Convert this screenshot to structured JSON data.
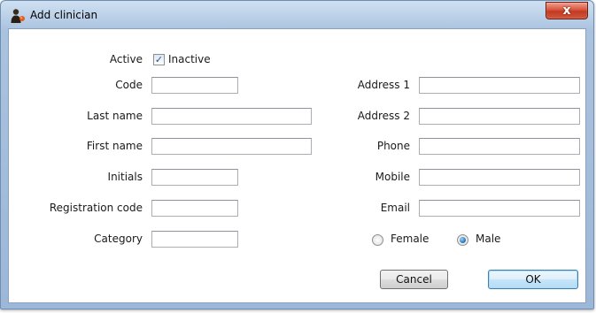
{
  "window": {
    "title": "Add clinician",
    "close_glyph": "x",
    "icon": "clinician-icon"
  },
  "form": {
    "active": {
      "label": "Active",
      "checkbox_label": "Inactive",
      "checked": true
    },
    "left_fields": [
      {
        "label": "Code",
        "value": ""
      },
      {
        "label": "Last name",
        "value": ""
      },
      {
        "label": "First name",
        "value": ""
      },
      {
        "label": "Initials",
        "value": ""
      },
      {
        "label": "Registration code",
        "value": ""
      },
      {
        "label": "Category",
        "value": ""
      }
    ],
    "right_fields": [
      {
        "label": "Address 1",
        "value": ""
      },
      {
        "label": "Address 2",
        "value": ""
      },
      {
        "label": "Phone",
        "value": ""
      },
      {
        "label": "Mobile",
        "value": ""
      },
      {
        "label": "Email",
        "value": ""
      }
    ],
    "gender": {
      "options": [
        "Female",
        "Male"
      ],
      "selected": "Male"
    }
  },
  "buttons": {
    "cancel": "Cancel",
    "ok": "OK"
  },
  "colors": {
    "frame": "#a9c2df",
    "close_button": "#c23a22",
    "default_button_border": "#3c7fb1"
  }
}
